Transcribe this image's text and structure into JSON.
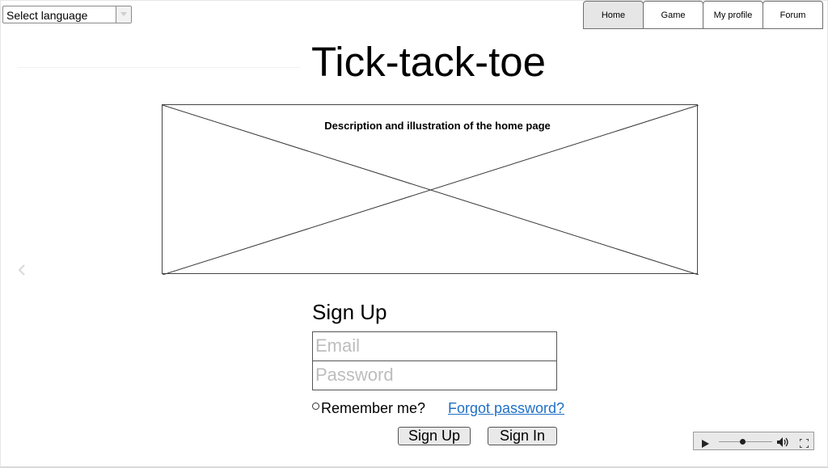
{
  "language_select": {
    "selected": "Select language",
    "icon": "chevron-down-icon"
  },
  "nav": {
    "tabs": [
      {
        "label": "Home",
        "active": true
      },
      {
        "label": "Game",
        "active": false
      },
      {
        "label": "My profile",
        "active": false
      },
      {
        "label": "Forum",
        "active": false
      }
    ]
  },
  "page": {
    "title": "Tick-tack-toe"
  },
  "hero": {
    "caption": "Description and illustration of the home page"
  },
  "carousel": {
    "prev_icon": "chevron-left-icon"
  },
  "signup_form": {
    "title": "Sign Up",
    "email_placeholder": "Email",
    "password_placeholder": "Password",
    "remember_label": "Remember me?",
    "forgot_link": "Forgot password?",
    "signup_button": "Sign Up",
    "signin_button": "Sign In"
  },
  "media_player": {
    "play_icon": "play-icon",
    "volume_icon": "volume-icon",
    "fullscreen_icon": "fullscreen-icon",
    "progress": 0.45
  },
  "colors": {
    "link": "#1f6fc5",
    "active_tab": "#e6e6e6",
    "placeholder_text": "#bdbdbd"
  }
}
